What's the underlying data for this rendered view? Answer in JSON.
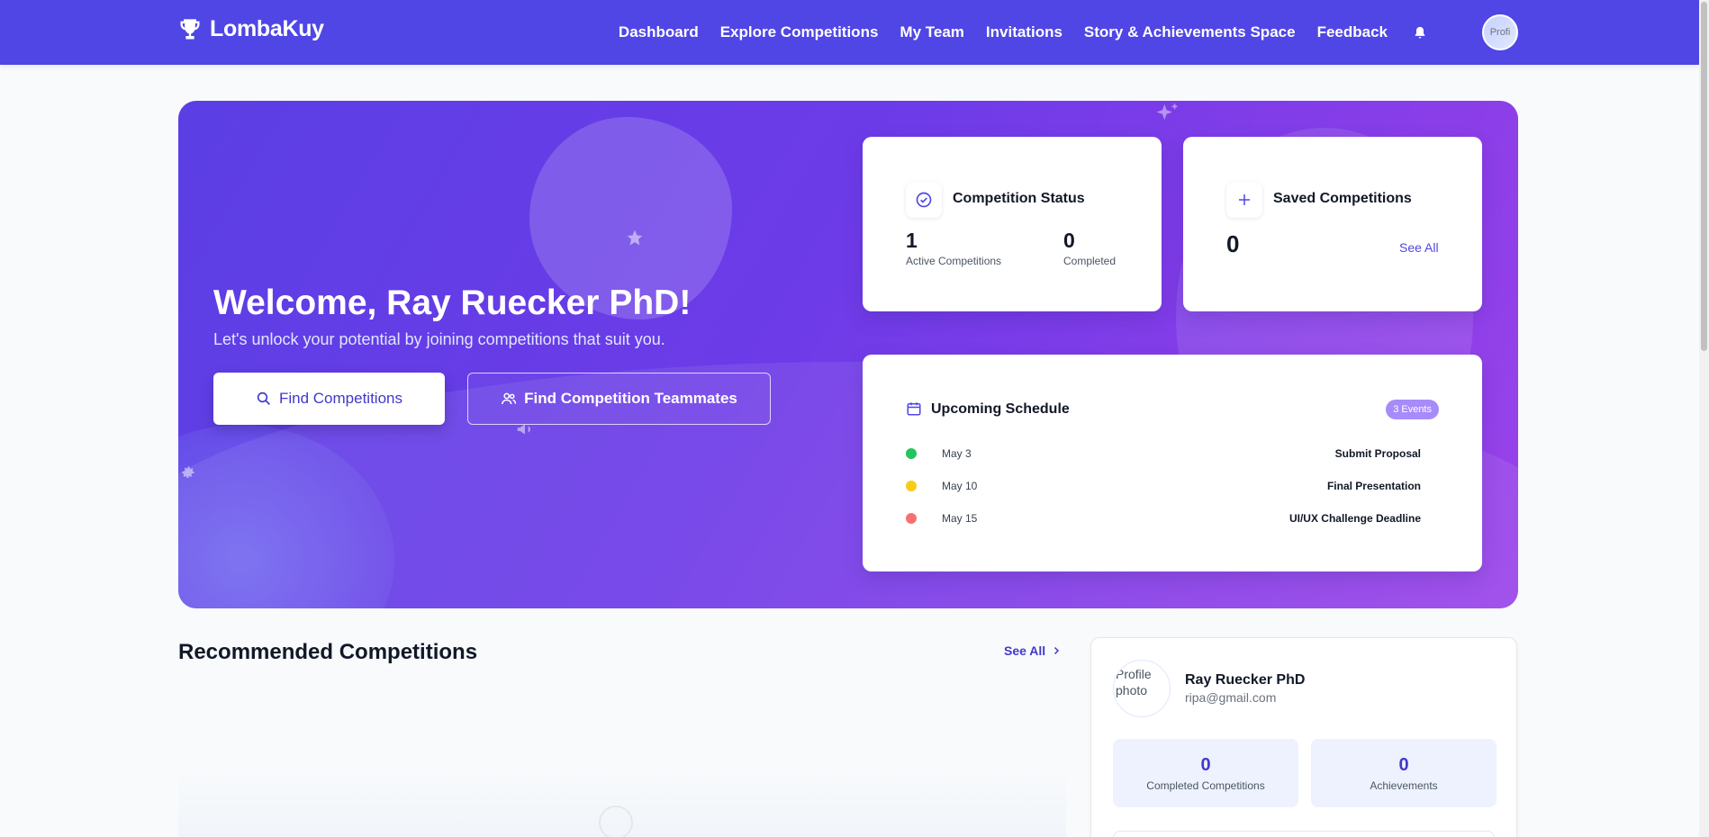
{
  "nav": {
    "brand": "LombaKuy",
    "links": [
      "Dashboard",
      "Explore Competitions",
      "My Team",
      "Invitations",
      "Story & Achievements Space",
      "Feedback"
    ],
    "avatar_alt": "Profi"
  },
  "hero": {
    "welcome": "Welcome, Ray Ruecker PhD!",
    "subtitle": "Let's unlock your potential by joining competitions that suit you.",
    "find_competitions": "Find Competitions",
    "find_teammates": "Find Competition Teammates"
  },
  "status_card": {
    "title": "Competition Status",
    "active_count": "1",
    "active_label": "Active Competitions",
    "completed_count": "0",
    "completed_label": "Completed"
  },
  "saved_card": {
    "title": "Saved Competitions",
    "count": "0",
    "see_all": "See All"
  },
  "schedule": {
    "title": "Upcoming Schedule",
    "badge": "3 Events",
    "events": [
      {
        "date": "May 3",
        "name": "Submit Proposal",
        "color": "#22c55e"
      },
      {
        "date": "May 10",
        "name": "Final Presentation",
        "color": "#facc15"
      },
      {
        "date": "May 15",
        "name": "UI/UX Challenge Deadline",
        "color": "#f87171"
      }
    ]
  },
  "recommended": {
    "title": "Recommended Competitions",
    "see_all": "See All"
  },
  "profile": {
    "photo_alt": "Profile photo",
    "name": "Ray Ruecker PhD",
    "email": "ripa@gmail.com",
    "completed_count": "0",
    "completed_label": "Completed Competitions",
    "achievements_count": "0",
    "achievements_label": "Achievements"
  },
  "colors": {
    "navbar": "#4f46e5",
    "accent": "#4338ca"
  }
}
